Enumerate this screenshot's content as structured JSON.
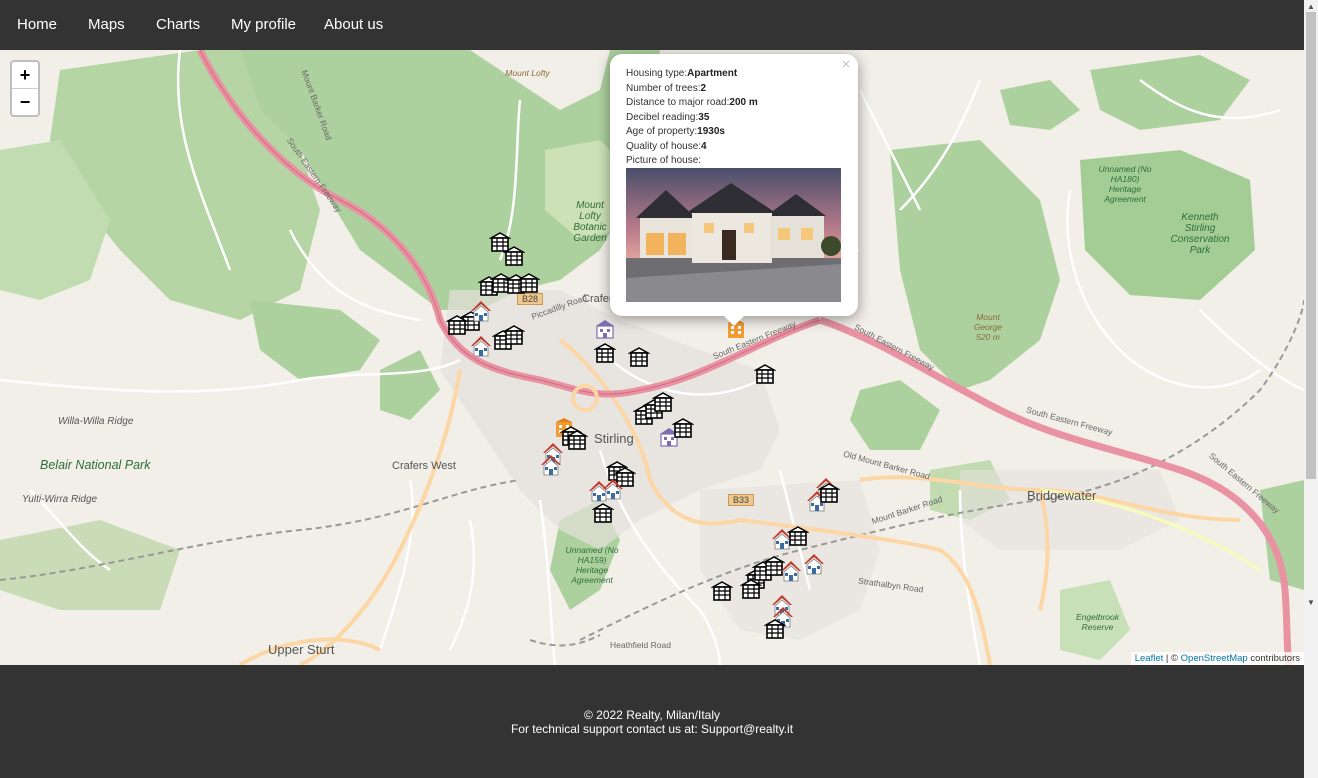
{
  "nav": {
    "items": [
      "Home",
      "Maps",
      "Charts",
      "My profile",
      "About us"
    ]
  },
  "map": {
    "zoom_in": "+",
    "zoom_out": "−",
    "labels": {
      "belair": "Belair National Park",
      "willa": "Willa-Willa Ridge",
      "yulti": "Yulti-Wirra Ridge",
      "crafers_west": "Crafers West",
      "stirling": "Stirling",
      "bridgewater": "Bridgewater",
      "upper_sturt": "Upper Sturt",
      "kenneth": "Kenneth Stirling Conservation Park",
      "unnamed_ha180": "Unnamed (No HA180) Heritage Agreement",
      "unnamed_ha159": "Unnamed (No HA159) Heritage Agreement",
      "engelbrook": "Engelbrook Reserve",
      "mount_lofty": "Mount Lofty",
      "mount_lofty_gardens": "Mount Lofty Botanic Garden",
      "mount_george": "Mount George 520 m",
      "crafers": "Crafers",
      "sef": "South Eastern Freeway",
      "mount_barker_road": "Mount Barker Road",
      "piccadilly": "Piccadilly Road",
      "heathfield": "Heathfield Road",
      "strathalbyn": "Strathalbyn Road",
      "old_mount_barker": "Old Mount Barker Road",
      "b28": "B28",
      "b33": "B33"
    },
    "popup": {
      "close": "×",
      "rows": [
        {
          "label": "Housing type:",
          "value": "Apartment"
        },
        {
          "label": "Number of trees:",
          "value": "2"
        },
        {
          "label": "Distance to major road:",
          "value": "200 m"
        },
        {
          "label": "Decibel reading:",
          "value": "35"
        },
        {
          "label": "Age of property:",
          "value": "1930s"
        },
        {
          "label": "Quality of house:",
          "value": "4"
        }
      ],
      "picture_label": "Picture of house:"
    },
    "attribution": {
      "leaflet": "Leaflet",
      "sep": " | © ",
      "osm": "OpenStreetMap",
      "tail": " contributors"
    }
  },
  "footer": {
    "line1": "© 2022 Realty, Milan/Italy",
    "line2": "For technical support contact us at: Support@realty.it"
  },
  "colors": {
    "nav_bg": "#333333",
    "park_green": "#add19e",
    "freeway_pink": "#e892a2",
    "primary_road": "#fcd6a4",
    "marker_red": "#c0392b"
  }
}
